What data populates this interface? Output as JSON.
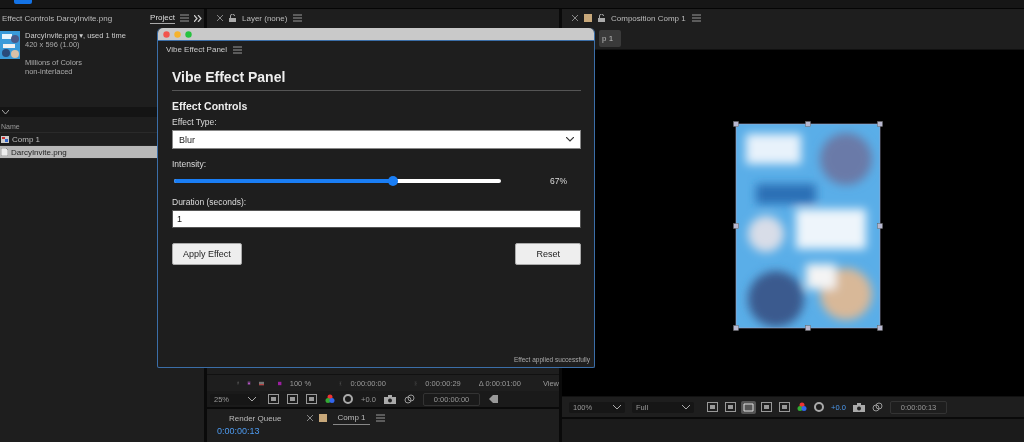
{
  "project_panel": {
    "tabs": [
      {
        "label": "Effect Controls DarcyInvite.png",
        "selected": false
      },
      {
        "label": "Project",
        "selected": true
      }
    ],
    "footage": {
      "name": "DarcyInvite.png ▾",
      "usage": ", used 1 time",
      "dimensions": "420 x 596 (1.00)",
      "color_depth": "Millions of Colors",
      "scan": "non-interlaced"
    },
    "column": "Name",
    "items": [
      {
        "name": "Comp 1",
        "kind": "composition",
        "selected": false
      },
      {
        "name": "DarcyInvite.png",
        "kind": "footage",
        "selected": true
      }
    ]
  },
  "layer_panel": {
    "title": "Layer (none)",
    "zoom_percent": "100 %",
    "in_point": "0:00:00:00",
    "out_point": "0:00:00:29",
    "duration": "Δ 0:00:01:00",
    "view_label": "View",
    "magnification": "25%",
    "exposure": "+0.0",
    "current_time": "0:00:00:00"
  },
  "timeline": {
    "tabs": [
      {
        "label": "Render Queue",
        "selected": false
      },
      {
        "label": "Comp 1",
        "selected": true
      }
    ],
    "current_time": "0:00:00:13"
  },
  "composition_panel": {
    "title": "Composition Comp 1",
    "tab": "p 1",
    "magnification": "100%",
    "resolution": "Full",
    "exposure": "+0.0",
    "current_time": "0:00:00:13"
  },
  "plugin_window": {
    "tab": "Vibe Effect Panel",
    "heading": "Vibe Effect Panel",
    "section": "Effect Controls",
    "effect_type": {
      "label": "Effect Type:",
      "value": "Blur"
    },
    "intensity": {
      "label": "Intensity:",
      "level": 0.67,
      "reading": "67%"
    },
    "duration": {
      "label": "Duration (seconds):",
      "value": "1"
    },
    "buttons": [
      "Apply Effect",
      "Reset"
    ],
    "status": "Effect applied successfully"
  }
}
